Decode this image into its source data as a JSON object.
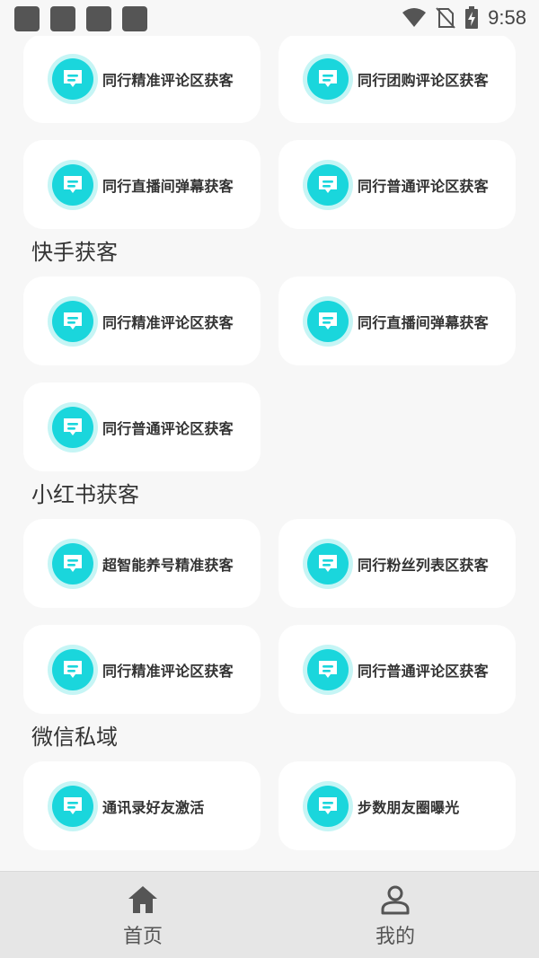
{
  "status_bar": {
    "time": "9:58"
  },
  "sections": [
    {
      "title": "",
      "items": [
        "同行精准评论区获客",
        "同行团购评论区获客",
        "同行直播间弹幕获客",
        "同行普通评论区获客"
      ]
    },
    {
      "title": "快手获客",
      "items": [
        "同行精准评论区获客",
        "同行直播间弹幕获客",
        "同行普通评论区获客"
      ]
    },
    {
      "title": "小红书获客",
      "items": [
        "超智能养号精准获客",
        "同行粉丝列表区获客",
        "同行精准评论区获客",
        "同行普通评论区获客"
      ]
    },
    {
      "title": "微信私域",
      "items": [
        "通讯录好友激活",
        "步数朋友圈曝光"
      ]
    }
  ],
  "bottom_nav": {
    "home": "首页",
    "mine": "我的"
  },
  "colors": {
    "accent": "#1ad6dc",
    "background": "#f7f7f7",
    "card": "#ffffff"
  },
  "icons": {
    "item": "message-icon",
    "home": "home-icon",
    "mine": "user-icon"
  }
}
